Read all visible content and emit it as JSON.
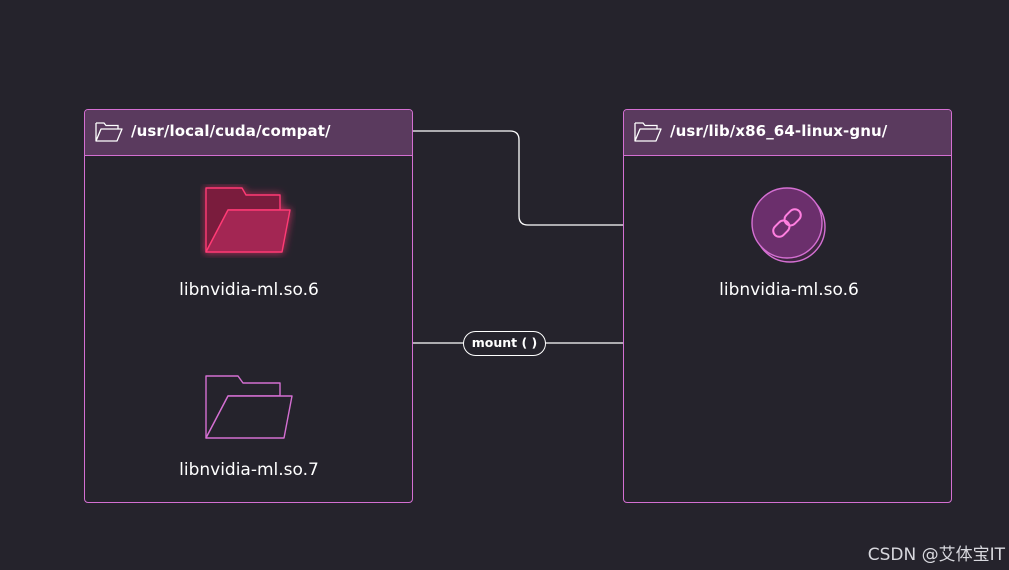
{
  "left_panel": {
    "title": "/usr/local/cuda/compat/",
    "icon": "folder-open-icon",
    "files": [
      {
        "name": "libnvidia-ml.so.6",
        "icon": "folder-open-icon",
        "highlighted": true
      },
      {
        "name": "libnvidia-ml.so.7",
        "icon": "folder-open-icon",
        "highlighted": false
      }
    ]
  },
  "right_panel": {
    "title": "/usr/lib/x86_64-linux-gnu/",
    "icon": "folder-open-icon",
    "files": [
      {
        "name": "libnvidia-ml.so.6",
        "icon": "link-icon"
      }
    ]
  },
  "connector": {
    "label": "mount ( )"
  },
  "watermark": {
    "text": "CSDN @艾体宝IT"
  },
  "colors": {
    "background": "#25232c",
    "border": "#d46fd2",
    "header": "#5a3a5e",
    "highlight": "#e0245e",
    "line": "#ffffff"
  }
}
